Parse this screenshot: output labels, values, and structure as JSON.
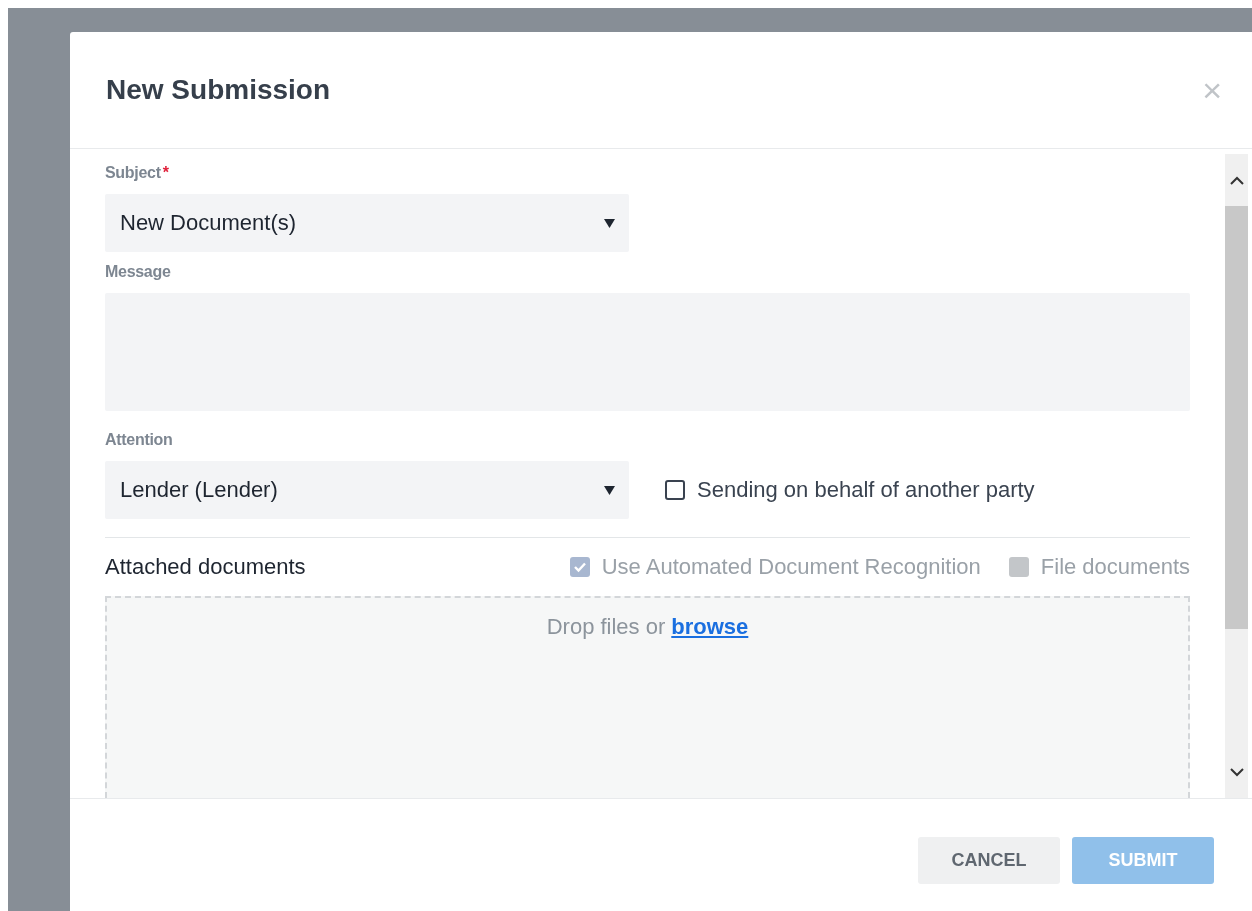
{
  "dialog": {
    "title": "New Submission",
    "close": "×"
  },
  "subject": {
    "label": "Subject",
    "required_mark": "*",
    "value": "New Document(s)"
  },
  "message": {
    "label": "Message"
  },
  "attention": {
    "label": "Attention",
    "value": "Lender (Lender)"
  },
  "behalf": {
    "label": "Sending on behalf of another party",
    "checked": false,
    "disabled": false
  },
  "attachments": {
    "title": "Attached documents",
    "options": [
      {
        "label": "Use Automated Document Recognition",
        "checked": true,
        "disabled": true
      },
      {
        "label": "File documents",
        "checked": false,
        "disabled": true
      }
    ],
    "drop_text": "Drop files or",
    "browse": "browse"
  },
  "buttons": [
    {
      "label": "CANCEL",
      "kind": "secondary",
      "disabled": false
    },
    {
      "label": "SUBMIT",
      "kind": "primary",
      "disabled": true
    }
  ]
}
